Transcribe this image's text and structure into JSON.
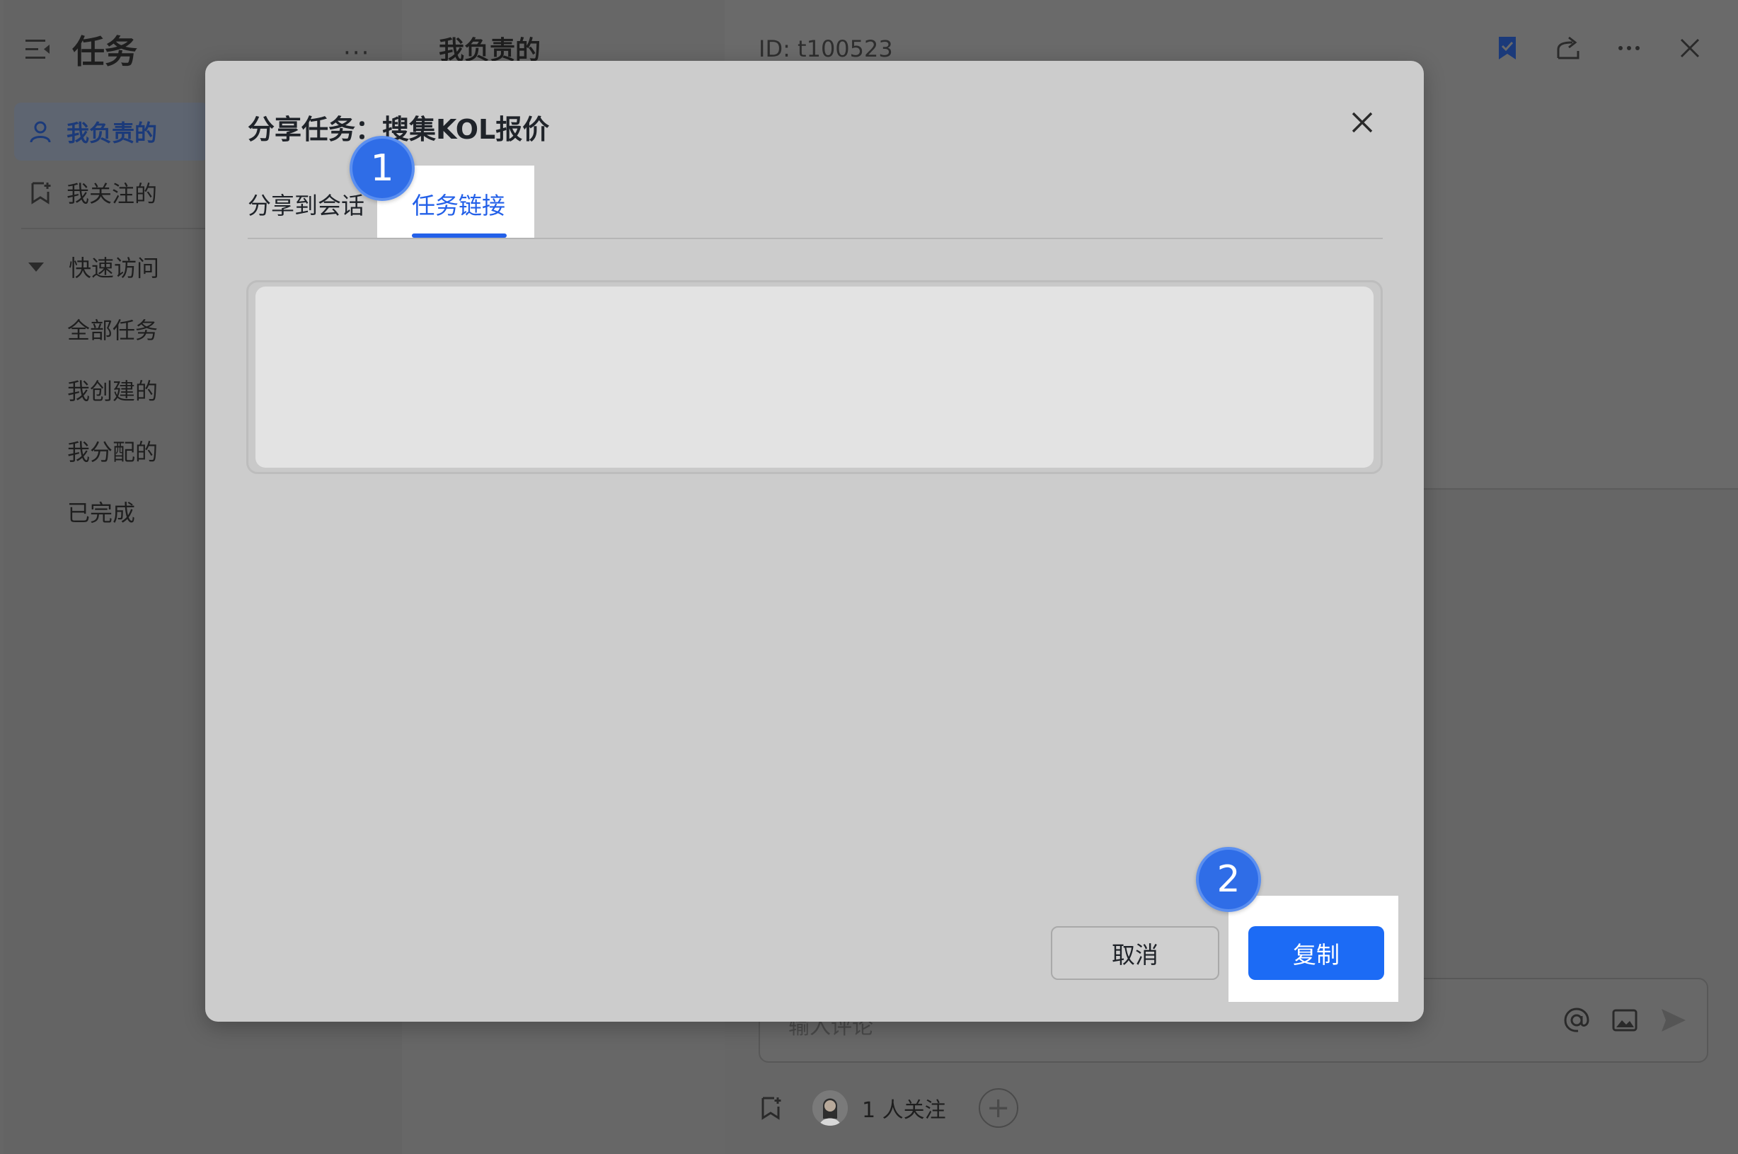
{
  "sidebar": {
    "title": "任务",
    "more": "···",
    "items": [
      {
        "label": "我负责的",
        "icon": "user-icon",
        "active": true
      },
      {
        "label": "我关注的",
        "icon": "follow-icon",
        "active": false
      }
    ],
    "group_label": "快速访问",
    "sub_items": [
      "全部任务",
      "我创建的",
      "我分配的",
      "已完成"
    ]
  },
  "list": {
    "title": "我负责的"
  },
  "detail": {
    "id_text": "ID: t100523",
    "comment_placeholder": "输入评论",
    "follow_count_text": "1 人关注",
    "add_label": "+"
  },
  "modal": {
    "title": "分享任务：搜集KOL报价",
    "tabs": [
      {
        "label": "分享到会话",
        "active": false
      },
      {
        "label": "任务链接",
        "active": true
      }
    ],
    "link_value": "",
    "cancel_label": "取消",
    "copy_label": "复制"
  },
  "markers": {
    "step1": "1",
    "step2": "2"
  },
  "colors": {
    "accent": "#1c6bf5",
    "marker": "#2f6de7",
    "highlight": "#ffffff"
  }
}
